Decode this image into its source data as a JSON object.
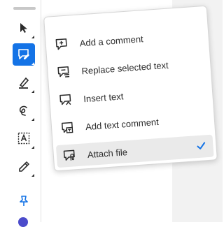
{
  "toolbar": {
    "tools": [
      {
        "icon": "pointer-icon"
      },
      {
        "icon": "comment-tool-icon",
        "active": true
      },
      {
        "icon": "highlight-pen-icon"
      },
      {
        "icon": "freehand-draw-icon"
      },
      {
        "icon": "text-box-icon"
      },
      {
        "icon": "fill-sign-icon"
      },
      {
        "icon": "pin-icon"
      }
    ],
    "accent_color": "#1473e6"
  },
  "menu": {
    "items": [
      {
        "label": "Add a comment",
        "icon": "add-comment-icon"
      },
      {
        "label": "Replace selected text",
        "icon": "replace-text-icon"
      },
      {
        "label": "Insert text",
        "icon": "insert-text-icon"
      },
      {
        "label": "Add text comment",
        "icon": "text-comment-icon"
      },
      {
        "label": "Attach file",
        "icon": "attach-file-icon",
        "selected": true
      }
    ],
    "check_color": "#1473e6"
  }
}
